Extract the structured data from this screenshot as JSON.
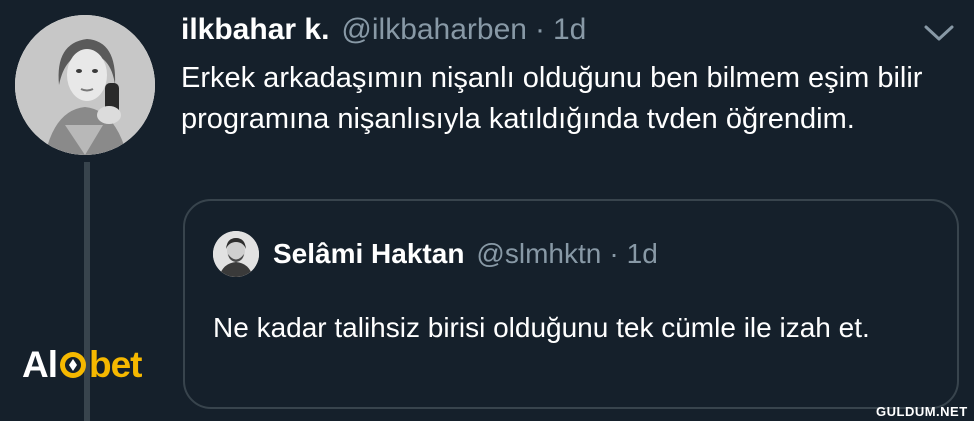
{
  "tweet": {
    "display_name": "ilkbahar k.",
    "handle": "@ilkbaharben",
    "separator": "·",
    "time": "1d",
    "text": "Erkek arkadaşımın nişanlı olduğunu ben bilmem eşim bilir programına nişanlısıyla katıldığında tvden öğrendim."
  },
  "quoted_tweet": {
    "display_name": "Selâmi Haktan",
    "handle": "@slmhktn",
    "separator": "·",
    "time": "1d",
    "text": "Ne kadar talihsiz birisi olduğunu tek cümle ile izah et."
  },
  "overlay": {
    "logo_part1": "Al",
    "logo_part2": "bet",
    "watermark": "GULDUM.NET"
  },
  "icons": {
    "menu": "chevron-down-icon"
  },
  "colors": {
    "background": "#15202b",
    "text": "#ffffff",
    "secondary_text": "#8899a6",
    "border": "#38444d",
    "logo_accent": "#f5b800"
  }
}
